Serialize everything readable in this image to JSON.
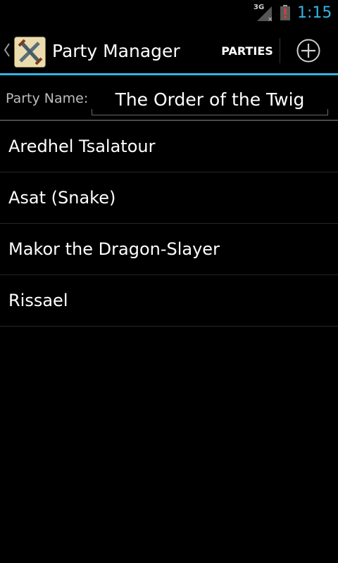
{
  "status_bar": {
    "network_label": "3G",
    "time": "1:15",
    "battery_icon": "battery-alert-icon",
    "signal_icon": "signal-no-data-icon"
  },
  "action_bar": {
    "title": "Party Manager",
    "parties_button": "PARTIES",
    "add_icon": "add-circle-icon",
    "accent_color": "#33b5e5"
  },
  "party": {
    "label": "Party Name:",
    "name": "The Order of the Twig"
  },
  "members": [
    {
      "name": "Aredhel Tsalatour"
    },
    {
      "name": "Asat (Snake)"
    },
    {
      "name": "Makor the Dragon-Slayer"
    },
    {
      "name": "Rissael"
    }
  ]
}
